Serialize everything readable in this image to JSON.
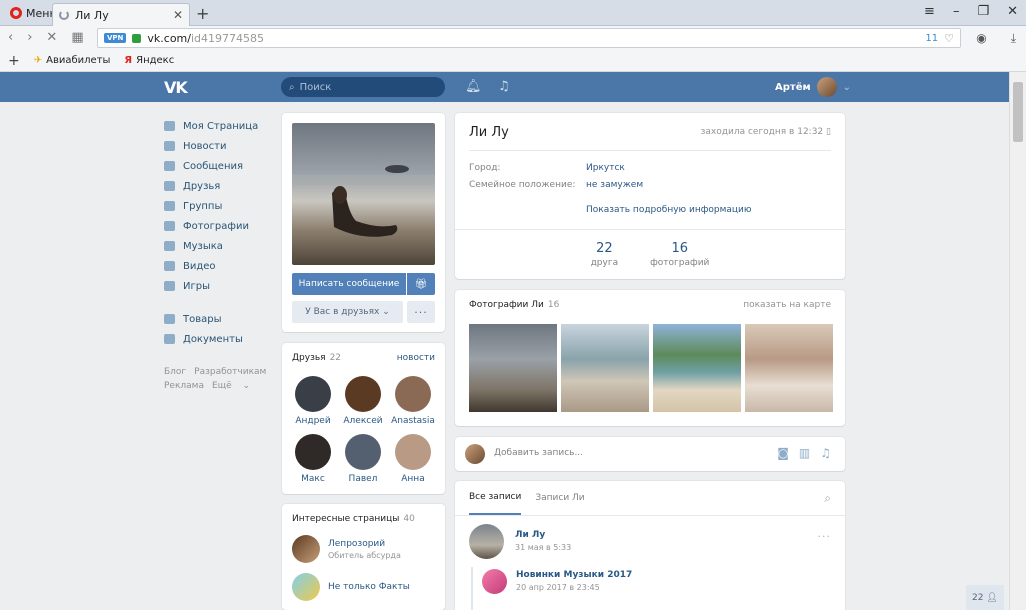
{
  "browser": {
    "menu_label": "Меню",
    "tab_title": "Ли Лу",
    "url_host": "vk.com/",
    "url_path": "id419774585",
    "vpn_label": "VPN",
    "ad_block_count": "11",
    "bookmarks": [
      {
        "label": "Авиабилеты",
        "icon": "plane-icon"
      },
      {
        "label": "Яндекс",
        "icon": "yandex-icon"
      }
    ]
  },
  "header": {
    "logo": "VK",
    "search_placeholder": "Поиск",
    "user_name": "Артём"
  },
  "left_nav": {
    "items": [
      {
        "label": "Моя Страница",
        "icon": "home-icon"
      },
      {
        "label": "Новости",
        "icon": "news-icon"
      },
      {
        "label": "Сообщения",
        "icon": "messages-icon"
      },
      {
        "label": "Друзья",
        "icon": "friends-icon"
      },
      {
        "label": "Группы",
        "icon": "groups-icon"
      },
      {
        "label": "Фотографии",
        "icon": "camera-icon"
      },
      {
        "label": "Музыка",
        "icon": "music-icon"
      },
      {
        "label": "Видео",
        "icon": "video-icon"
      },
      {
        "label": "Игры",
        "icon": "games-icon"
      }
    ],
    "items_extra": [
      {
        "label": "Товары",
        "icon": "goods-icon"
      },
      {
        "label": "Документы",
        "icon": "docs-icon"
      }
    ],
    "footer": [
      "Блог",
      "Разработчикам",
      "Реклама",
      "Ещё"
    ]
  },
  "profile": {
    "write_message": "Написать сообщение",
    "friend_status": "У Вас в друзьях",
    "name": "Ли Лу",
    "last_seen": "заходила сегодня в 12:32",
    "city_label": "Город:",
    "city_value": "Иркутск",
    "relationship_label": "Семейное положение:",
    "relationship_value": "не замужем",
    "show_details": "Показать подробную информацию",
    "counters": [
      {
        "value": "22",
        "label": "друга"
      },
      {
        "value": "16",
        "label": "фотографий"
      }
    ]
  },
  "friends": {
    "title": "Друзья",
    "count": "22",
    "link": "новости",
    "items": [
      {
        "name": "Андрей",
        "color": "#3a3f47"
      },
      {
        "name": "Алексей",
        "color": "#5a3a22"
      },
      {
        "name": "Anastasia",
        "color": "#8a6a55"
      },
      {
        "name": "Макс",
        "color": "#2f2a28"
      },
      {
        "name": "Павел",
        "color": "#546070"
      },
      {
        "name": "Анна",
        "color": "#b89a85"
      }
    ]
  },
  "pages": {
    "title": "Интересные страницы",
    "count": "40",
    "items": [
      {
        "name": "Лепрозорий",
        "sub": "Обитель абсурда"
      },
      {
        "name": "Не только Факты",
        "sub": ""
      }
    ]
  },
  "photos": {
    "title": "Фотографии Ли",
    "count": "16",
    "map_link": "показать на карте"
  },
  "compose": {
    "placeholder": "Добавить запись..."
  },
  "wall": {
    "tabs": [
      "Все записи",
      "Записи Ли"
    ],
    "post_author": "Ли Лу",
    "post_date": "31 мая в 5:33",
    "repost_author": "Новинки Музыки 2017",
    "repost_date": "20 апр 2017 в 23:45"
  },
  "online_count": "22"
}
